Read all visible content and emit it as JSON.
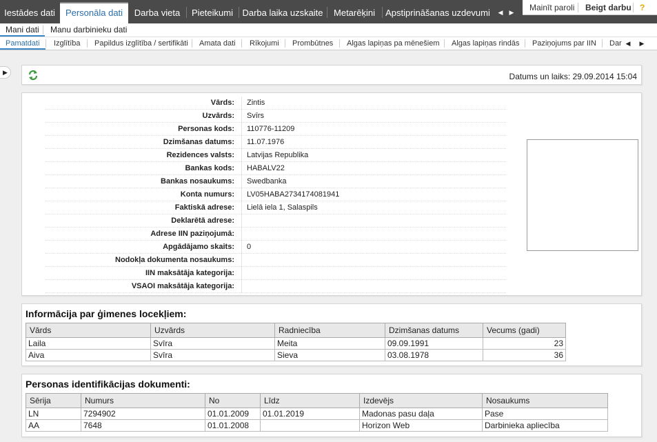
{
  "top_menu": {
    "tabs": [
      "Iestādes dati",
      "Personāla dati",
      "Darba vieta",
      "Pieteikumi",
      "Darba laika uzskaite",
      "Metarēķini",
      "Apstiprināšanas uzdevumi"
    ],
    "active_index": 1
  },
  "top_right": {
    "change_password": "Mainīt paroli",
    "logout": "Beigt darbu",
    "help": "?"
  },
  "sub_menu": {
    "items": [
      "Mani dati",
      "Manu darbinieku dati"
    ],
    "active_index": 0
  },
  "tabs": {
    "items": [
      "Pamatdati",
      "Izglītība",
      "Papildus izglītība / sertifikāti",
      "Amata dati",
      "Rīkojumi",
      "Prombūtnes",
      "Algas lapiņas pa mēnešiem",
      "Algas lapiņas rindās",
      "Paziņojums par IIN",
      "Dar"
    ],
    "active_index": 0
  },
  "header": {
    "datetime_label": "Datums un laiks: 29.09.2014 15:04"
  },
  "person": {
    "fields": [
      {
        "label": "Vārds:",
        "value": "Zintis"
      },
      {
        "label": "Uzvārds:",
        "value": "Svīrs"
      },
      {
        "label": "Personas kods:",
        "value": "110776-11209"
      },
      {
        "label": "Dzimšanas datums:",
        "value": "11.07.1976"
      },
      {
        "label": "Rezidences valsts:",
        "value": "Latvijas Republika"
      },
      {
        "label": "Bankas kods:",
        "value": "HABALV22"
      },
      {
        "label": "Bankas nosaukums:",
        "value": "Swedbanka"
      },
      {
        "label": "Konta numurs:",
        "value": "LV05HABA2734174081941"
      },
      {
        "label": "Faktiskā adrese:",
        "value": "Lielā iela 1, Salaspils"
      },
      {
        "label": "Deklarētā adrese:",
        "value": ""
      },
      {
        "label": "Adrese IIN paziņojumā:",
        "value": ""
      },
      {
        "label": "Apgādājamo skaits:",
        "value": "0"
      },
      {
        "label": "Nodokļa dokumenta nosaukums:",
        "value": ""
      },
      {
        "label": "IIN maksātāja kategorija:",
        "value": ""
      },
      {
        "label": "VSAOI maksātāja kategorija:",
        "value": ""
      }
    ]
  },
  "family": {
    "title": "Informācija par ģimenes locekļiem:",
    "columns": [
      "Vārds",
      "Uzvārds",
      "Radniecība",
      "Dzimšanas datums",
      "Vecums (gadi)"
    ],
    "rows": [
      [
        "Laila",
        "Svīra",
        "Meita",
        "09.09.1991",
        "23"
      ],
      [
        "Aiva",
        "Svīra",
        "Sieva",
        "03.08.1978",
        "36"
      ]
    ]
  },
  "documents": {
    "title": "Personas identifikācijas dokumenti:",
    "columns": [
      "Sērija",
      "Numurs",
      "No",
      "Līdz",
      "Izdevējs",
      "Nosaukums"
    ],
    "rows": [
      [
        "LN",
        "7294902",
        "01.01.2009",
        "01.01.2019",
        "Madonas pasu daļa",
        "Pase"
      ],
      [
        "AA",
        "7648",
        "01.01.2008",
        "",
        "Horizon Web",
        "Darbinieka apliecība"
      ]
    ]
  },
  "icons": {
    "refresh": "refresh-icon",
    "toggle": "chevron-right-icon"
  },
  "colors": {
    "accent": "#2a6ea8",
    "topbar": "#4a4a4a",
    "refresh_green": "#3a9a3a"
  }
}
